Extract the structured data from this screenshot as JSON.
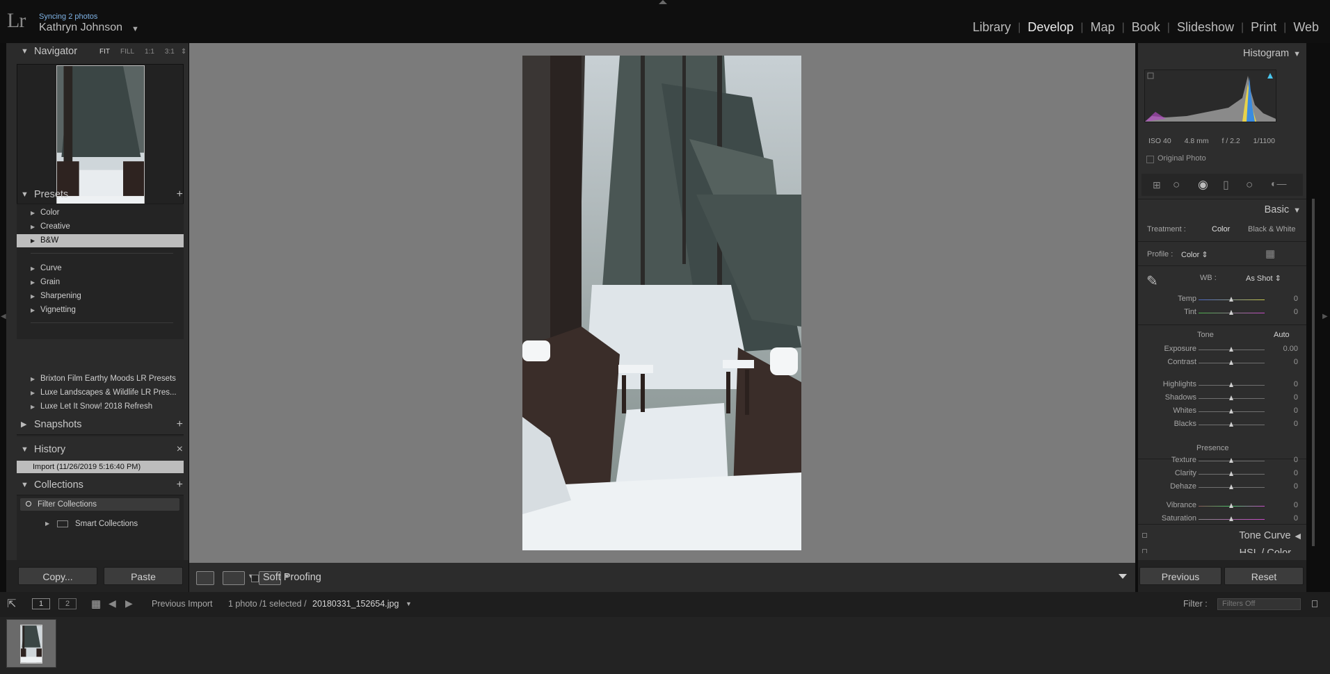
{
  "app": {
    "logo": "Lr",
    "sync_status": "Syncing 2 photos",
    "user_name": "Kathryn Johnson"
  },
  "modules": [
    "Library",
    "Develop",
    "Map",
    "Book",
    "Slideshow",
    "Print",
    "Web"
  ],
  "active_module": "Develop",
  "navigator": {
    "title": "Navigator",
    "zoom_options": [
      "FIT",
      "FILL",
      "1:1",
      "3:1"
    ],
    "active_zoom": "FIT"
  },
  "presets": {
    "title": "Presets",
    "items": [
      "Color",
      "Creative",
      "B&W",
      "Curve",
      "Grain",
      "Sharpening",
      "Vignetting",
      "Brixton Film Earthy Moods LR Presets",
      "Luxe Landscapes & Wildlife LR Pres...",
      "Luxe Let It Snow! 2018 Refresh"
    ],
    "selected": "B&W"
  },
  "snapshots": {
    "title": "Snapshots"
  },
  "history": {
    "title": "History",
    "items": [
      "Import (11/26/2019 5:16:40 PM)"
    ]
  },
  "collections": {
    "title": "Collections",
    "filter_label": "Filter Collections",
    "items": [
      "Smart Collections"
    ]
  },
  "left_buttons": {
    "copy": "Copy...",
    "paste": "Paste"
  },
  "toolbar": {
    "soft_proofing": "Soft Proofing"
  },
  "histogram": {
    "title": "Histogram",
    "iso": "ISO 40",
    "focal": "4.8 mm",
    "aperture": "f / 2.2",
    "shutter": "1/1100",
    "original_photo": "Original Photo"
  },
  "basic": {
    "title": "Basic",
    "treatment_label": "Treatment :",
    "treatment_color": "Color",
    "treatment_bw": "Black & White",
    "profile_label": "Profile :",
    "profile_value": "Color",
    "wb_label": "WB :",
    "wb_value": "As Shot",
    "tone_label": "Tone",
    "auto_label": "Auto",
    "presence_label": "Presence",
    "sliders": [
      {
        "label": "Temp",
        "value": "0"
      },
      {
        "label": "Tint",
        "value": "0"
      },
      {
        "label": "Exposure",
        "value": "0.00"
      },
      {
        "label": "Contrast",
        "value": "0"
      },
      {
        "label": "Highlights",
        "value": "0"
      },
      {
        "label": "Shadows",
        "value": "0"
      },
      {
        "label": "Whites",
        "value": "0"
      },
      {
        "label": "Blacks",
        "value": "0"
      },
      {
        "label": "Texture",
        "value": "0"
      },
      {
        "label": "Clarity",
        "value": "0"
      },
      {
        "label": "Dehaze",
        "value": "0"
      },
      {
        "label": "Vibrance",
        "value": "0"
      },
      {
        "label": "Saturation",
        "value": "0"
      }
    ]
  },
  "tone_curve": {
    "title": "Tone Curve"
  },
  "hsl": {
    "title": "HSL / Color"
  },
  "right_buttons": {
    "previous": "Previous",
    "reset": "Reset"
  },
  "filmstrip": {
    "page_1": "1",
    "page_2": "2",
    "source": "Previous Import",
    "count": "1 photo /1 selected /",
    "filename": "20180331_152654.jpg",
    "filter_label": "Filter :",
    "filter_value": "Filters Off"
  },
  "colors": {
    "panel": "#2b2b2b",
    "canvas": "#7b7b7b",
    "selected_row": "#bdbdbd",
    "sync_blue": "#7fb3e6"
  }
}
